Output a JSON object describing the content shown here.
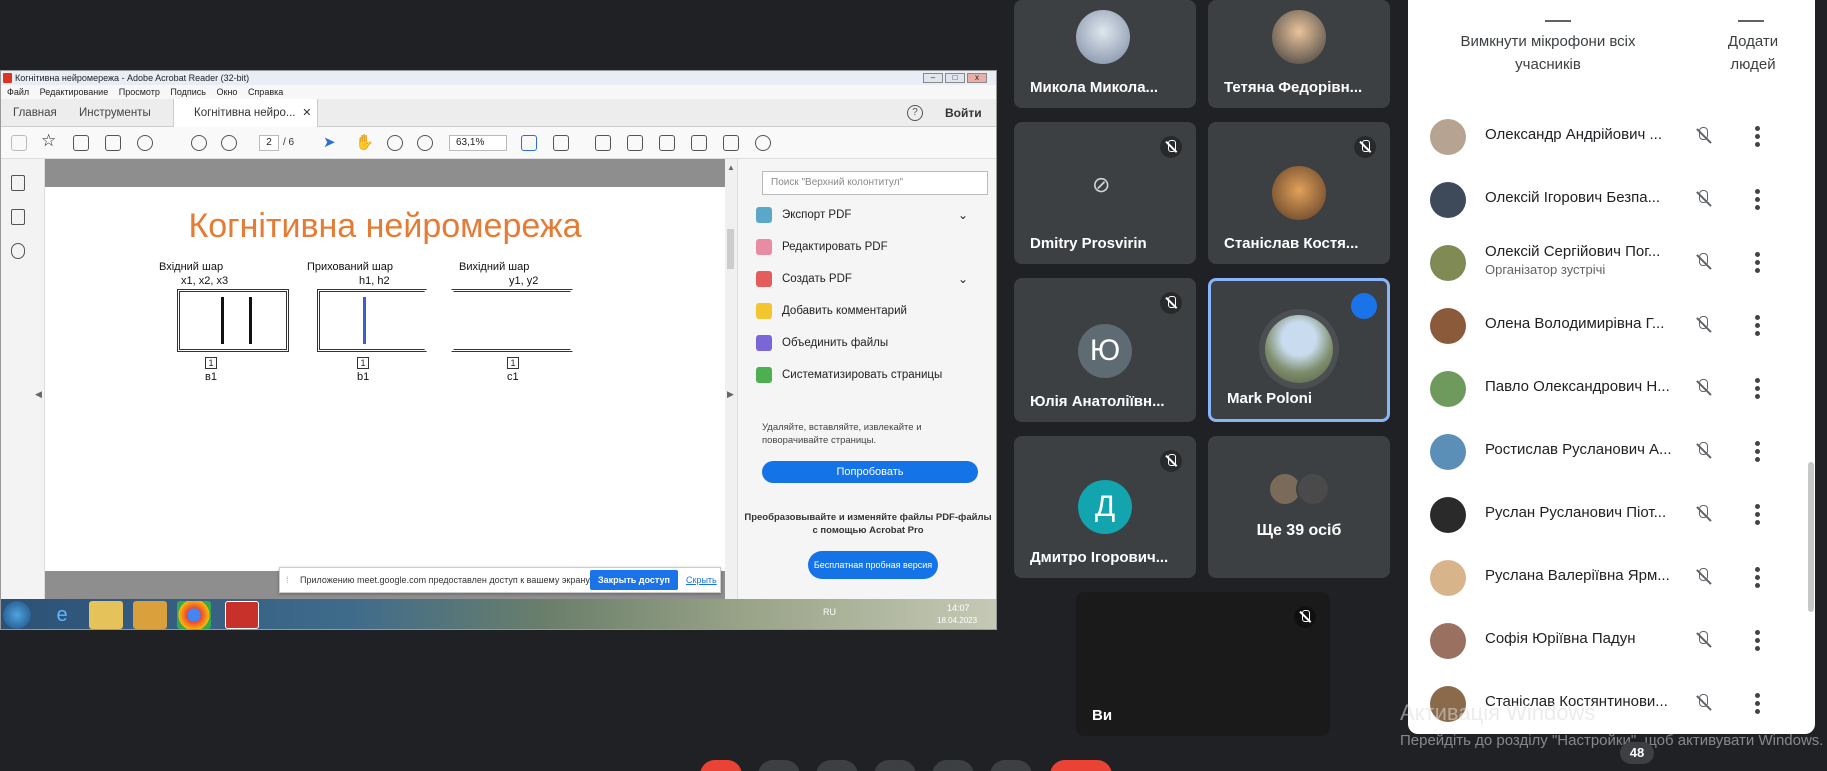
{
  "acrobat": {
    "window_title": "Когнітивна нейромережа - Adobe Acrobat Reader (32-bit)",
    "menu": [
      "Файл",
      "Редактирование",
      "Просмотр",
      "Подпись",
      "Окно",
      "Справка"
    ],
    "tabs": {
      "home": "Главная",
      "tools": "Инструменты",
      "doc": "Когнітивна нейро..."
    },
    "login": "Войти",
    "page_current": "2",
    "page_total": "/ 6",
    "zoom": "63,1%",
    "slide": {
      "title": "Когнітивна нейромережа",
      "input_layer": "Вхідний шар",
      "input_vars": "x1, x2, x3",
      "hidden_layer": "Прихований шар",
      "hidden_vars": "h1, h2",
      "output_layer": "Вихідний шар",
      "output_vars": "y1, y2",
      "bias_in": "в1",
      "bias_hidden": "b1",
      "bias_out": "c1",
      "bias_mark": "1"
    },
    "right_panel": {
      "search_placeholder": "Поиск \"Верхний колонтитул\"",
      "tools": [
        "Экспорт PDF",
        "Редактировать PDF",
        "Создать PDF",
        "Добавить комментарий",
        "Объединить файлы",
        "Систематизировать страницы"
      ],
      "note": "Удаляйте, вставляйте, извлекайте и поворачивайте страницы.",
      "try_button": "Попробовать",
      "promo": "Преобразовывайте и изменяйте файлы PDF-файлы с помощью Acrobat Pro",
      "free_button": "Бесплатная пробная версия"
    },
    "share_bar": {
      "text": "Приложению meet.google.com предоставлен доступ к вашему экрану.",
      "close": "Закрыть доступ",
      "hide": "Скрыть"
    },
    "taskbar": {
      "lang": "RU",
      "time": "14:07",
      "date": "18.04.2023"
    }
  },
  "tiles": [
    {
      "name": "Микола Микола..."
    },
    {
      "name": "Тетяна Федорівн..."
    },
    {
      "name": "Dmitry Prosvirin"
    },
    {
      "name": "Станіслав Костя..."
    },
    {
      "name": "Юлія Анатоліївн...",
      "letter": "Ю"
    },
    {
      "name": "Mark Poloni"
    },
    {
      "name": "Дмитро Ігорович...",
      "letter": "Д"
    },
    {
      "name": "Ще 39 осіб"
    },
    {
      "name": "Ви"
    }
  ],
  "people_panel": {
    "mute_all": "Вимкнути мікрофони всіх учасників",
    "add_people": "Додати людей",
    "people": [
      {
        "name": "Олександр Андрійович ..."
      },
      {
        "name": "Олексій Ігорович Безпа..."
      },
      {
        "name": "Олексій Сергійович Пог...",
        "role": "Організатор зустрічі"
      },
      {
        "name": "Олена Володимирівна Г..."
      },
      {
        "name": "Павло Олександрович Н..."
      },
      {
        "name": "Ростислав Русланович А..."
      },
      {
        "name": "Руслан Русланович Піот..."
      },
      {
        "name": "Руслана Валеріївна Ярм..."
      },
      {
        "name": "Софія Юріївна Падун"
      },
      {
        "name": "Станіслав Костянтинови..."
      }
    ]
  },
  "windows_activation": {
    "title": "Активація Windows",
    "text": "Перейдіть до розділу \"Настройки\", щоб активувати Windows."
  },
  "participant_count": "48"
}
